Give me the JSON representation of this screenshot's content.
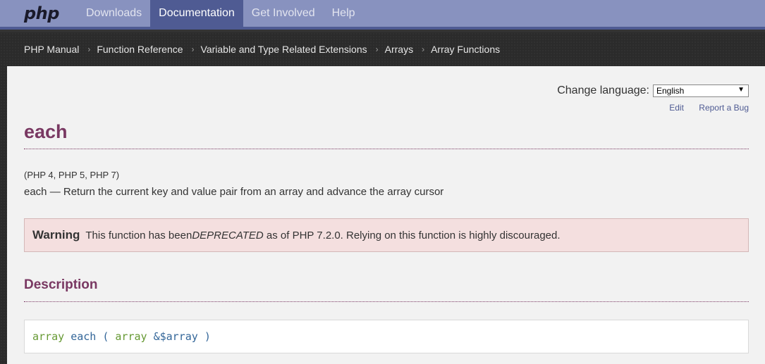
{
  "nav": {
    "logo": "php",
    "items": [
      {
        "label": "Downloads",
        "active": false
      },
      {
        "label": "Documentation",
        "active": true
      },
      {
        "label": "Get Involved",
        "active": false
      },
      {
        "label": "Help",
        "active": false
      }
    ]
  },
  "breadcrumb": [
    "PHP Manual",
    "Function Reference",
    "Variable and Type Related Extensions",
    "Arrays",
    "Array Functions"
  ],
  "breadcrumb_separator": "›",
  "language": {
    "label": "Change language:",
    "selected": "English"
  },
  "links": {
    "edit": "Edit",
    "report_bug": "Report a Bug"
  },
  "page": {
    "title": "each",
    "versions": "(PHP 4, PHP 5, PHP 7)",
    "refpurpose": "each — Return the current key and value pair from an array and advance the array cursor"
  },
  "warning": {
    "label": "Warning",
    "text_before": "This function has been ",
    "emphasis": "DEPRECATED",
    "text_after": " as of PHP 7.2.0. Relying on this function is highly discouraged."
  },
  "description": {
    "heading": "Description",
    "return_type": "array",
    "function_name": "each",
    "open_paren": "( ",
    "param_type": "array",
    "param_name": "&$array",
    "close_paren": " )"
  },
  "colors": {
    "nav_bg": "#8892bf",
    "nav_active": "#4f5b93",
    "heading": "#793862",
    "warning_bg": "#f4dfdf"
  }
}
